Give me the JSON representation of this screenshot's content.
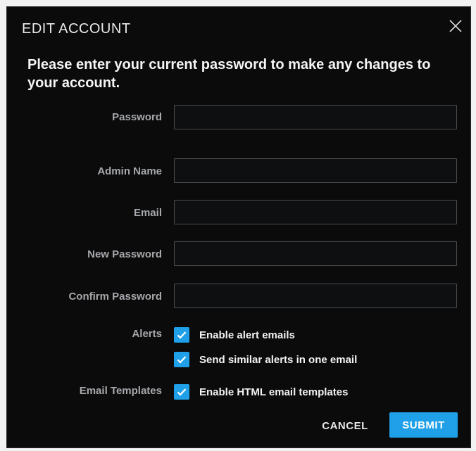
{
  "dialog": {
    "title": "EDIT ACCOUNT",
    "close_icon": "close-icon",
    "intro": "Please enter your current password to make any changes to your account."
  },
  "form": {
    "password_label": "Password",
    "password_value": "",
    "admin_name_label": "Admin Name",
    "admin_name_value": "",
    "email_label": "Email",
    "email_value": "",
    "new_password_label": "New Password",
    "new_password_value": "",
    "confirm_password_label": "Confirm Password",
    "confirm_password_value": ""
  },
  "alerts": {
    "label": "Alerts",
    "options": [
      {
        "label": "Enable alert emails",
        "checked": true
      },
      {
        "label": "Send similar alerts in one email",
        "checked": true
      }
    ]
  },
  "email_templates": {
    "label": "Email Templates",
    "options": [
      {
        "label": "Enable HTML email templates",
        "checked": true
      }
    ]
  },
  "buttons": {
    "cancel_label": "CANCEL",
    "submit_label": "SUBMIT"
  },
  "colors": {
    "accent": "#1fa0e8",
    "background": "#0b0b0c",
    "label_gray": "#a6a8ab"
  }
}
